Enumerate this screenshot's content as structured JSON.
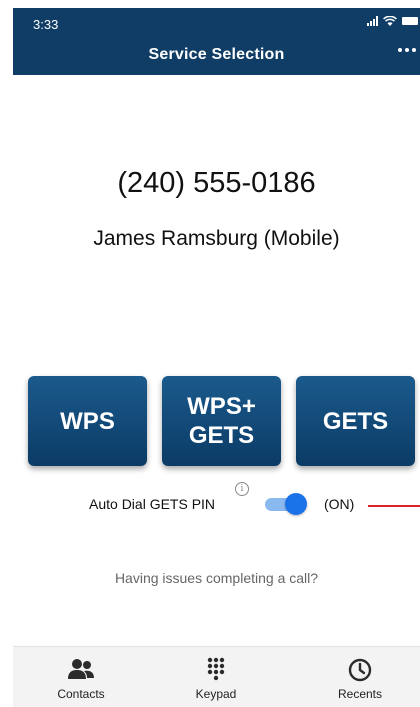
{
  "status_bar": {
    "time": "3:33"
  },
  "header": {
    "title": "Service Selection",
    "more_icon": "more-horizontal-icon"
  },
  "call": {
    "phone_number": "(240) 555-0186",
    "contact_name": "James Ramsburg (Mobile)"
  },
  "services": {
    "wps_label": "WPS",
    "wps_gets_line1": "WPS+",
    "wps_gets_line2": "GETS",
    "gets_label": "GETS"
  },
  "auto_dial": {
    "label": "Auto Dial GETS PIN",
    "info_icon": "info-icon",
    "enabled": true,
    "state_text": "(ON)"
  },
  "help_link": "Having issues completing a call?",
  "tabs": [
    {
      "label": "Contacts",
      "icon": "contacts-icon"
    },
    {
      "label": "Keypad",
      "icon": "keypad-icon"
    },
    {
      "label": "Recents",
      "icon": "clock-icon"
    }
  ],
  "colors": {
    "header_bg": "#0f3d66",
    "button_bg": "#0b3b66",
    "toggle_on": "#1a73e8",
    "indicator_line": "#d9242b"
  }
}
